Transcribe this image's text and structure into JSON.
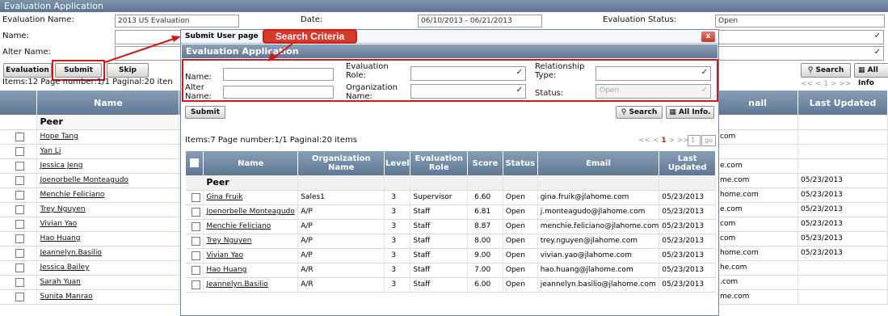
{
  "app": {
    "title": "Evaluation Application"
  },
  "form": {
    "eval_name_label": "Evaluation Name:",
    "eval_name_value": "2013 US Evaluation",
    "date_label": "Date:",
    "date_value": "06/10/2013 - 06/21/2013",
    "status_label": "Evaluation Status:",
    "status_value": "Open",
    "name_label": "Name:",
    "alter_name_label": "Alter Name:"
  },
  "toolbar": {
    "evaluation": "Evaluation",
    "submit": "Submit",
    "skip": "Skip",
    "search": "Search",
    "all_info": "All Info",
    "pager": "<< < 1 > >>"
  },
  "bg_status": {
    "text": "Items:12   Page number:1/1   Paginal:20 iten"
  },
  "bg_table": {
    "headers": [
      "Name",
      "nail",
      "Last Updated"
    ],
    "group": "Peer",
    "rows": [
      {
        "name": "Hope Tang",
        "email": "com",
        "updated": ""
      },
      {
        "name": "Yan Li",
        "email": "",
        "updated": ""
      },
      {
        "name": "Jessica Jeng",
        "email": "e.com",
        "updated": ""
      },
      {
        "name": "Joenorbelle Monteagudo",
        "email": "me.com",
        "updated": "05/23/2013"
      },
      {
        "name": "Menchie Feliciano",
        "email": "home.com",
        "updated": "05/23/2013"
      },
      {
        "name": "Trey Nguyen",
        "email": "e.com",
        "updated": "05/23/2013"
      },
      {
        "name": "Vivian Yao",
        "email": "com",
        "updated": "05/23/2013"
      },
      {
        "name": "Hao Huang",
        "email": "com",
        "updated": "05/23/2013"
      },
      {
        "name": "Jeannelyn.Basilio",
        "email": "home.com",
        "updated": "05/23/2013"
      },
      {
        "name": "Jessica Bailey",
        "email": "he.com",
        "updated": ""
      },
      {
        "name": "Sarah Yuan",
        "email": ".com",
        "updated": ""
      },
      {
        "name": "Sunita Manrao",
        "email": "me.com",
        "updated": ""
      }
    ]
  },
  "modal": {
    "title": "Submit User page",
    "close": "x",
    "header": "Evaluation Application",
    "name_label": "Name:",
    "eval_role_label": "Evaluation Role:",
    "relationship_label": "Relationship Type:",
    "alter_name_label": "Alter Name:",
    "org_name_label": "Organization Name:",
    "status_label": "Status:",
    "status_value": "Open",
    "submit": "Submit",
    "search": "Search",
    "all_info": "All Info.",
    "status_text": "Items:7   Page number:1/1   Paginal:20 items",
    "pager_left": "<< <",
    "pager_page": "1",
    "pager_right": "> >>",
    "page_input": "1",
    "go": "go",
    "headers": [
      "Name",
      "Organization Name",
      "Level",
      "Evaluation Role",
      "Score",
      "Status",
      "Email",
      "Last Updated"
    ],
    "group": "Peer",
    "rows": [
      {
        "name": "Gina Fruik",
        "org": "Sales1",
        "level": "3",
        "role": "Supervisor",
        "score": "6.60",
        "status": "Open",
        "email": "gina.fruik@jlahome.com",
        "updated": "05/23/2013"
      },
      {
        "name": "Joenorbelle Monteagudo",
        "org": "A/P",
        "level": "3",
        "role": "Staff",
        "score": "6.81",
        "status": "Open",
        "email": "j.monteagudo@jlahome.com",
        "updated": "05/23/2013"
      },
      {
        "name": "Menchie Feliciano",
        "org": "A/P",
        "level": "3",
        "role": "Staff",
        "score": "8.87",
        "status": "Open",
        "email": "menchie.feliciano@jlahome.com",
        "updated": "05/23/2013"
      },
      {
        "name": "Trey Nguyen",
        "org": "A/P",
        "level": "3",
        "role": "Staff",
        "score": "8.00",
        "status": "Open",
        "email": "trey.nguyen@jlahome.com",
        "updated": "05/23/2013"
      },
      {
        "name": "Vivian Yao",
        "org": "A/P",
        "level": "3",
        "role": "Staff",
        "score": "9.00",
        "status": "Open",
        "email": "vivian.yao@jlahome.com",
        "updated": "05/23/2013"
      },
      {
        "name": "Hao Huang",
        "org": "A/R",
        "level": "3",
        "role": "Staff",
        "score": "7.00",
        "status": "Open",
        "email": "hao.huang@jlahome.com",
        "updated": "05/23/2013"
      },
      {
        "name": "Jeannelyn.Basilio",
        "org": "A/R",
        "level": "3",
        "role": "Staff",
        "score": "6.00",
        "status": "Open",
        "email": "jeannelyn.basilio@jlahome.com",
        "updated": "05/23/2013"
      }
    ]
  },
  "callout": {
    "label": "Search Criteria"
  },
  "colors": {
    "header_bg": "#5f7994",
    "accent_red": "#cc1b1b"
  }
}
